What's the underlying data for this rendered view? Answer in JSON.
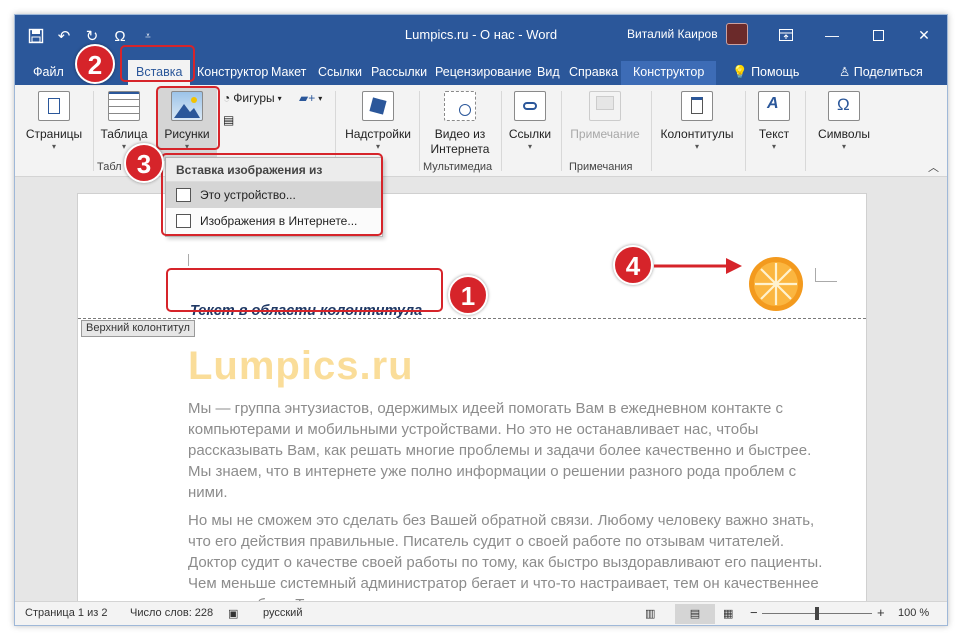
{
  "window": {
    "title": "Lumpics.ru - О нас  -  Word",
    "user": "Виталий Каиров",
    "quick_access": [
      "save-icon",
      "undo-icon",
      "redo-icon",
      "omega-icon",
      "customize-icon"
    ],
    "controls": [
      "ribbon-display-icon",
      "minimize-icon",
      "maximize-icon",
      "close-icon"
    ]
  },
  "tabs": {
    "file": "Файл",
    "insert": "Вставка",
    "design": "Конструктор",
    "layout": "Макет",
    "references": "Ссылки",
    "mailings": "Рассылки",
    "review": "Рецензирование",
    "view": "Вид",
    "help": "Справка",
    "context": "Конструктор",
    "tell_me": "Помощь",
    "share": "Поделиться"
  },
  "ribbon": {
    "pages": "Страницы",
    "table": "Таблица",
    "pictures": "Рисунки",
    "shapes": "Фигуры",
    "addins": "Надстройки",
    "online_video_line1": "Видео из",
    "online_video_line2": "Интернета",
    "links": "Ссылки",
    "comment": "Примечание",
    "header_footer": "Колонтитулы",
    "text": "Текст",
    "symbols": "Символы",
    "group_tables": "Табл",
    "group_media": "Мультимедиа",
    "group_comments": "Примечания"
  },
  "dropdown": {
    "header": "Вставка изображения из",
    "items": [
      "Это устройство...",
      "Изображения в Интернете..."
    ]
  },
  "document": {
    "header_label": "Верхний колонтитул",
    "header_text": "Текст в области колонтитула",
    "title": "Lumpics.ru",
    "paragraph1": "Мы — группа энтузиастов, одержимых идеей помогать Вам в ежедневном контакте с компьютерами и мобильными устройствами. Но это не останавливает нас, чтобы рассказывать Вам, как решать многие проблемы и задачи более качественно и быстрее. Мы знаем, что в интернете уже полно информации о решении разного рода проблем с ними.",
    "paragraph2": "Но мы не сможем это сделать без Вашей обратной связи. Любому человеку важно знать, что его действия правильные. Писатель судит о своей работе по отзывам читателей. Доктор судит о качестве своей работы по тому, как быстро выздоравливают его пациенты. Чем меньше системный администратор бегает и что-то настраивает, тем он качественнее делает работу. Так и мы не можем"
  },
  "statusbar": {
    "page": "Страница 1 из 2",
    "words": "Число слов: 228",
    "language": "русский",
    "zoom_minus": "−",
    "zoom_plus": "+",
    "zoom": "100 %"
  },
  "annotations": [
    "1",
    "2",
    "3",
    "4"
  ],
  "colors": {
    "word_blue": "#2b579a",
    "annotation_red": "#d6242a",
    "orange": "#f39a1e"
  }
}
